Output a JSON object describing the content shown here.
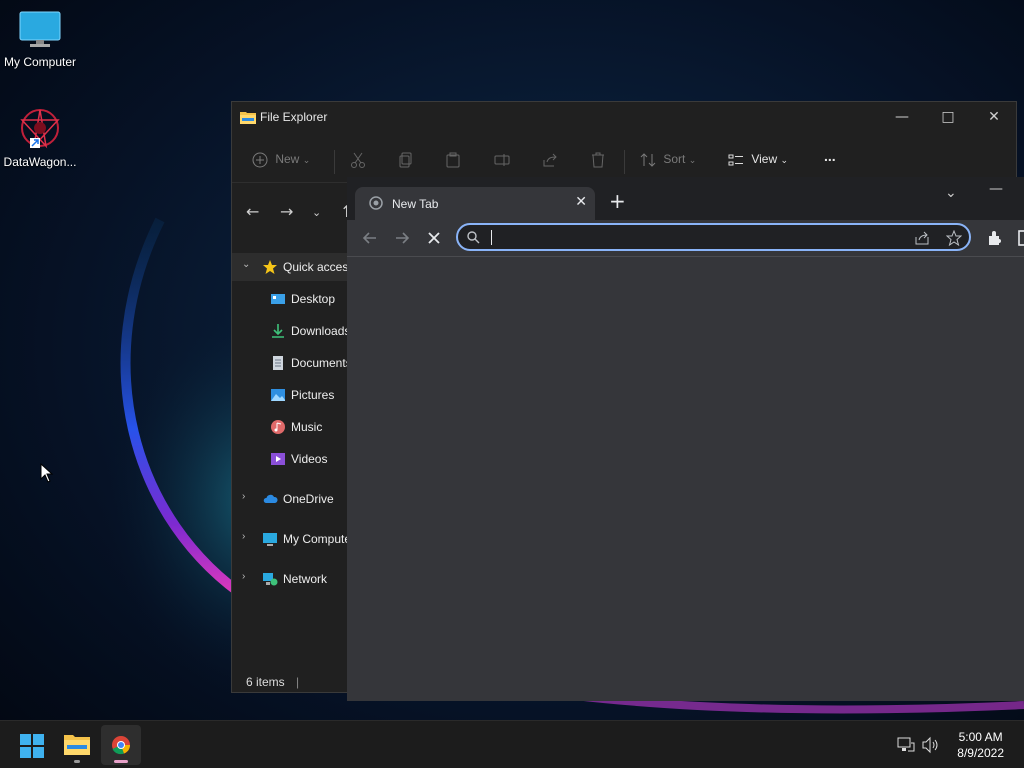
{
  "desktop": {
    "icons": [
      {
        "label": "My Computer",
        "icon": "monitor-icon"
      },
      {
        "label": "DataWagon...",
        "icon": "datawagon-icon"
      }
    ]
  },
  "explorer": {
    "title": "File Explorer",
    "commands": {
      "new_label": "New",
      "sort_label": "Sort",
      "view_label": "View",
      "more_label": "..."
    },
    "sidebar": [
      {
        "label": "Quick access",
        "icon": "star-icon"
      },
      {
        "label": "Desktop",
        "icon": "desktop-folder-icon"
      },
      {
        "label": "Downloads",
        "icon": "download-icon"
      },
      {
        "label": "Documents",
        "icon": "document-icon"
      },
      {
        "label": "Pictures",
        "icon": "pictures-icon"
      },
      {
        "label": "Music",
        "icon": "music-icon"
      },
      {
        "label": "Videos",
        "icon": "videos-icon"
      },
      {
        "label": "OneDrive",
        "icon": "cloud-icon"
      },
      {
        "label": "My Computer",
        "icon": "monitor-icon"
      },
      {
        "label": "Network",
        "icon": "network-icon"
      }
    ],
    "status": "6 items"
  },
  "browser": {
    "tab_title": "New Tab",
    "tab_close": "✕",
    "new_tab": "+",
    "address_value": "",
    "accent": "#8ab4f8"
  },
  "taskbar": {
    "time": "5:00 AM",
    "date": "8/9/2022"
  }
}
